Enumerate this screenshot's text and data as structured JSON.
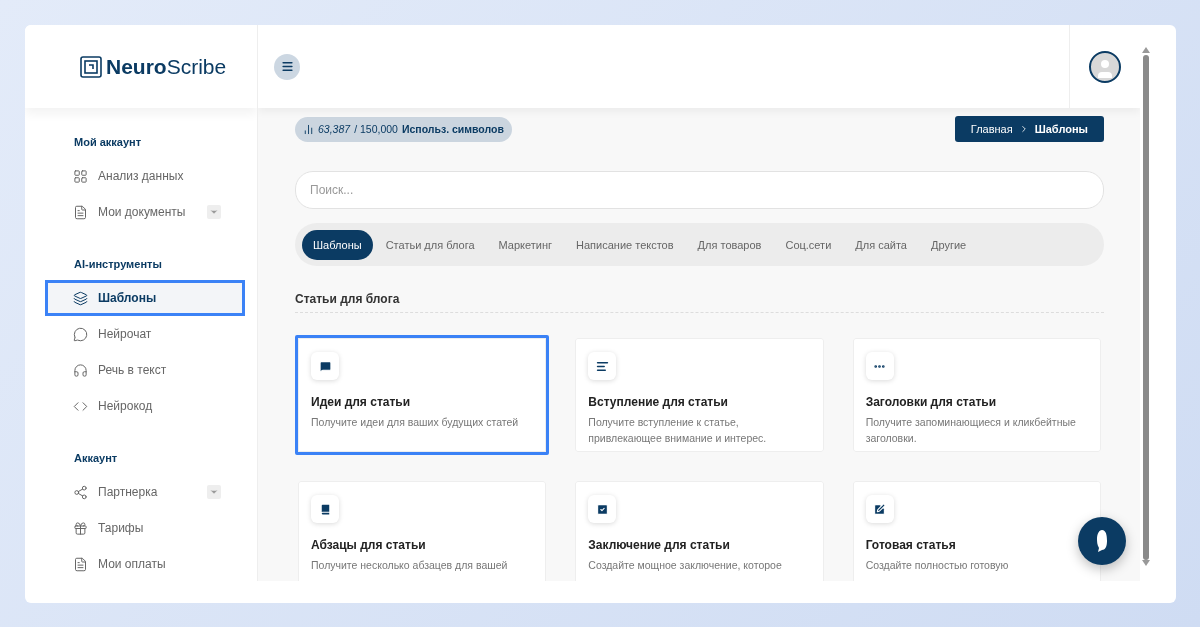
{
  "logo": {
    "bold": "Neuro",
    "light": "Scribe"
  },
  "sidebar": {
    "sections": [
      {
        "title": "Мой аккаунт",
        "items": [
          {
            "label": "Анализ данных",
            "selected": false,
            "highlighted": false,
            "has_submenu": false
          },
          {
            "label": "Мои документы",
            "selected": false,
            "highlighted": false,
            "has_submenu": true
          }
        ]
      },
      {
        "title": "AI-инструменты",
        "items": [
          {
            "label": "Шаблоны",
            "selected": true,
            "highlighted": true,
            "has_submenu": false
          },
          {
            "label": "Нейрочат",
            "selected": false,
            "highlighted": false,
            "has_submenu": false
          },
          {
            "label": "Речь в текст",
            "selected": false,
            "highlighted": false,
            "has_submenu": false
          },
          {
            "label": "Нейрокод",
            "selected": false,
            "highlighted": false,
            "has_submenu": false
          }
        ]
      },
      {
        "title": "Аккаунт",
        "items": [
          {
            "label": "Партнерка",
            "selected": false,
            "highlighted": false,
            "has_submenu": true
          },
          {
            "label": "Тарифы",
            "selected": false,
            "highlighted": false,
            "has_submenu": false
          },
          {
            "label": "Мои оплаты",
            "selected": false,
            "highlighted": false,
            "has_submenu": false
          }
        ]
      }
    ]
  },
  "usage": {
    "used": "63,387",
    "total": "/ 150,000",
    "label": "Использ. символов"
  },
  "breadcrumb": [
    "Главная",
    "Шаблоны"
  ],
  "search": {
    "placeholder": "Поиск..."
  },
  "tabs": [
    {
      "label": "Шаблоны",
      "selected": true
    },
    {
      "label": "Статьи для блога",
      "selected": false
    },
    {
      "label": "Маркетинг",
      "selected": false
    },
    {
      "label": "Написание текстов",
      "selected": false
    },
    {
      "label": "Для товаров",
      "selected": false
    },
    {
      "label": "Соц.сети",
      "selected": false
    },
    {
      "label": "Для сайта",
      "selected": false
    },
    {
      "label": "Другие",
      "selected": false
    }
  ],
  "section_title": "Статьи для блога",
  "cards": [
    {
      "title": "Идеи для статьи",
      "description": "Получите идеи для ваших будущих статей",
      "highlighted": true
    },
    {
      "title": "Вступление для статьи",
      "description": "Получите вступление к статье, привлекающее внимание и интерес.",
      "highlighted": false
    },
    {
      "title": "Заголовки для статьи",
      "description": "Получите запоминающиеся и кликбейтные заголовки.",
      "highlighted": false
    },
    {
      "title": "Абзацы для статьи",
      "description": "Получите несколько абзацев для вашей",
      "highlighted": false
    },
    {
      "title": "Заключение для статьи",
      "description": "Создайте мощное заключение, которое",
      "highlighted": false
    },
    {
      "title": "Готовая статья",
      "description": "Создайте полностью готовую",
      "highlighted": false
    }
  ]
}
